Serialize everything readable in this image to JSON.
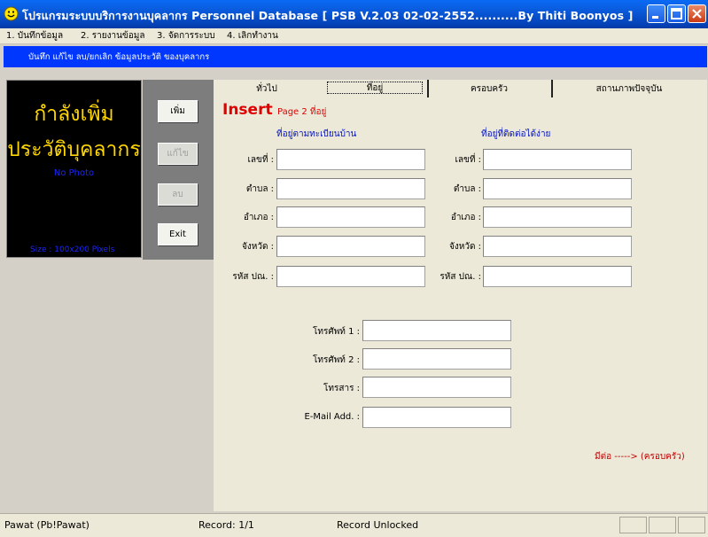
{
  "window": {
    "title": "โปรแกรมระบบบริการงานบุคลากร Personnel Database   [ PSB  V.2.03  02-02-2552..........By  Thiti  Boonyos ]",
    "icon": "smiley-icon"
  },
  "menu": [
    "1. บันทึกข้อมูล",
    "2. รายงานข้อมูล",
    "3. จัดการระบบ",
    "4. เลิกทำงาน"
  ],
  "header": {
    "text": "บันทึก  แก้ไข  ลบ/ยกเลิก  ข้อมูลประวัติ ของบุคลากร"
  },
  "photo": {
    "line1": "กำลังเพิ่ม",
    "line2": "ประวัติบุคลากร",
    "no_photo": "No Photo",
    "size": "Size : 100x200 Pixels"
  },
  "buttons": {
    "add": "เพิ่ม",
    "edit": "แก้ไข",
    "delete": "ลบ",
    "exit": "Exit"
  },
  "tabs": [
    "ทั่วไป",
    "ที่อยู่",
    "ครอบครัว",
    "สถานภาพปัจจุบัน"
  ],
  "active_tab": "ที่อยู่",
  "form": {
    "mode": "Insert",
    "page": "Page 2  ที่อยู่",
    "section_registered": "ที่อยู่ตามทะเบียนบ้าน",
    "section_contact": "ที่อยู่ที่ติดต่อได้ง่าย",
    "labels": {
      "number": "เลขที่ :",
      "subdistrict": "ตำบล :",
      "district": "อำเภอ :",
      "province": "จังหวัด :",
      "postcode": "รหัส ปณ. :",
      "phone1": "โทรศัพท์ 1 :",
      "phone2": "โทรศัพท์ 2 :",
      "fax": "โทรสาร :",
      "email": "E-Mail Add. :"
    },
    "values": {
      "reg_number": "",
      "reg_subdistrict": "",
      "reg_district": "",
      "reg_province": "",
      "reg_postcode": "",
      "con_number": "",
      "con_subdistrict": "",
      "con_district": "",
      "con_province": "",
      "con_postcode": "",
      "phone1": "",
      "phone2": "",
      "fax": "",
      "email": ""
    },
    "continued": "มีต่อ -----> (ครอบครัว)"
  },
  "status": {
    "user": "Pawat (Pb!Pawat)",
    "record": "Record: 1/1",
    "lock": "Record Unlocked"
  },
  "colors": {
    "title_bar": "#0a5ee0",
    "header_band": "#0037ff",
    "photo_text": "#ffd700",
    "insert": "#e00000",
    "section_heading": "#0010c8"
  }
}
